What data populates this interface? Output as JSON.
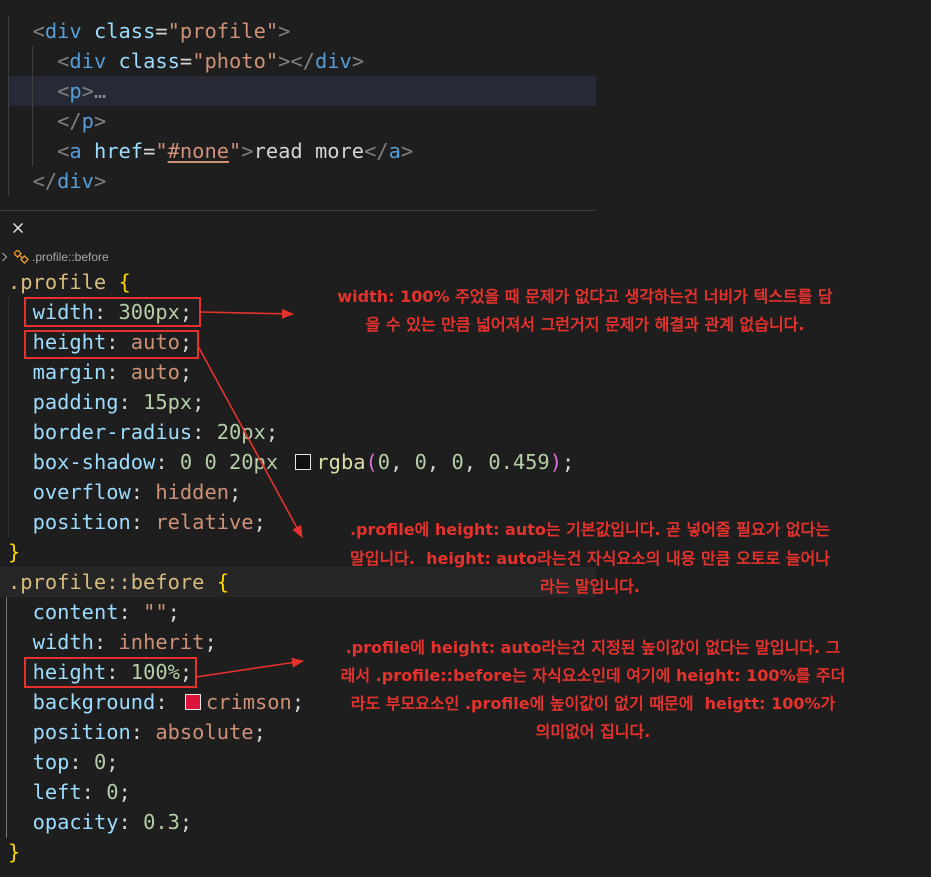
{
  "colors": {
    "annotation": "#e5322d"
  },
  "html_editor": {
    "lines": [
      [
        {
          "t": "  "
        },
        {
          "t": "<",
          "c": "#808080"
        },
        {
          "t": "div",
          "c": "#569cd6"
        },
        {
          "t": " "
        },
        {
          "t": "class",
          "c": "#9cdcfe"
        },
        {
          "t": "=",
          "c": "#d4d4d4"
        },
        {
          "t": "\"profile\"",
          "c": "#ce9178"
        },
        {
          "t": ">",
          "c": "#808080"
        }
      ],
      [
        {
          "t": "    "
        },
        {
          "t": "<",
          "c": "#808080"
        },
        {
          "t": "div",
          "c": "#569cd6"
        },
        {
          "t": " "
        },
        {
          "t": "class",
          "c": "#9cdcfe"
        },
        {
          "t": "=",
          "c": "#d4d4d4"
        },
        {
          "t": "\"photo\"",
          "c": "#ce9178"
        },
        {
          "t": ">",
          "c": "#808080"
        },
        {
          "t": "</",
          "c": "#808080"
        },
        {
          "t": "div",
          "c": "#569cd6"
        },
        {
          "t": ">",
          "c": "#808080"
        }
      ],
      [
        {
          "t": "    "
        },
        {
          "t": "<",
          "c": "#808080"
        },
        {
          "t": "p",
          "c": "#569cd6"
        },
        {
          "t": ">",
          "c": "#808080"
        },
        {
          "t": "…",
          "c": "#8c8c8c"
        }
      ],
      [
        {
          "t": "    "
        },
        {
          "t": "</",
          "c": "#808080"
        },
        {
          "t": "p",
          "c": "#569cd6"
        },
        {
          "t": ">",
          "c": "#808080"
        }
      ],
      [
        {
          "t": "    "
        },
        {
          "t": "<",
          "c": "#808080"
        },
        {
          "t": "a",
          "c": "#569cd6"
        },
        {
          "t": " "
        },
        {
          "t": "href",
          "c": "#9cdcfe"
        },
        {
          "t": "=",
          "c": "#d4d4d4"
        },
        {
          "t": "\"",
          "c": "#ce9178"
        },
        {
          "t": "#none",
          "c": "#ce9178",
          "underline": true
        },
        {
          "t": "\"",
          "c": "#ce9178"
        },
        {
          "t": ">",
          "c": "#808080"
        },
        {
          "t": "read more",
          "c": "#d4d4d4"
        },
        {
          "t": "</",
          "c": "#808080"
        },
        {
          "t": "a",
          "c": "#569cd6"
        },
        {
          "t": ">",
          "c": "#808080"
        }
      ],
      [
        {
          "t": "  "
        },
        {
          "t": "</",
          "c": "#808080"
        },
        {
          "t": "div",
          "c": "#569cd6"
        },
        {
          "t": ">",
          "c": "#808080"
        }
      ]
    ]
  },
  "panel": {
    "close_icon": "close-icon"
  },
  "breadcrumb": {
    "chevron_icon": "chevron-right-icon",
    "symbol_icon": "symbol-class-icon",
    "label": ".profile::before"
  },
  "css_editor": {
    "lines": [
      [
        {
          "t": ".profile",
          "c": "#d7ba7d"
        },
        {
          "t": " "
        },
        {
          "t": "{",
          "c": "#ffd700"
        }
      ],
      [
        {
          "t": "  "
        },
        {
          "t": "width",
          "c": "#9cdcfe"
        },
        {
          "t": ": "
        },
        {
          "t": "300px",
          "c": "#b5cea8"
        },
        {
          "t": ";"
        }
      ],
      [
        {
          "t": "  "
        },
        {
          "t": "height",
          "c": "#9cdcfe"
        },
        {
          "t": ": "
        },
        {
          "t": "auto",
          "c": "#ce9178"
        },
        {
          "t": ";"
        }
      ],
      [
        {
          "t": "  "
        },
        {
          "t": "margin",
          "c": "#9cdcfe"
        },
        {
          "t": ": "
        },
        {
          "t": "auto",
          "c": "#ce9178"
        },
        {
          "t": ";"
        }
      ],
      [
        {
          "t": "  "
        },
        {
          "t": "padding",
          "c": "#9cdcfe"
        },
        {
          "t": ": "
        },
        {
          "t": "15px",
          "c": "#b5cea8"
        },
        {
          "t": ";"
        }
      ],
      [
        {
          "t": "  "
        },
        {
          "t": "border-radius",
          "c": "#9cdcfe"
        },
        {
          "t": ": "
        },
        {
          "t": "20px",
          "c": "#b5cea8"
        },
        {
          "t": ";"
        }
      ],
      [
        {
          "t": "  "
        },
        {
          "t": "box-shadow",
          "c": "#9cdcfe"
        },
        {
          "t": ": "
        },
        {
          "t": "0 0 20px",
          "c": "#b5cea8"
        },
        {
          "t": " "
        },
        {
          "swatch": "#00000075"
        },
        {
          "t": "rgba",
          "c": "#dcdcaa"
        },
        {
          "t": "(",
          "c": "#da70d6"
        },
        {
          "t": "0",
          "c": "#b5cea8"
        },
        {
          "t": ", "
        },
        {
          "t": "0",
          "c": "#b5cea8"
        },
        {
          "t": ", "
        },
        {
          "t": "0",
          "c": "#b5cea8"
        },
        {
          "t": ", "
        },
        {
          "t": "0.459",
          "c": "#b5cea8"
        },
        {
          "t": ")",
          "c": "#da70d6"
        },
        {
          "t": ";"
        }
      ],
      [
        {
          "t": "  "
        },
        {
          "t": "overflow",
          "c": "#9cdcfe"
        },
        {
          "t": ": "
        },
        {
          "t": "hidden",
          "c": "#ce9178"
        },
        {
          "t": ";"
        }
      ],
      [
        {
          "t": "  "
        },
        {
          "t": "position",
          "c": "#9cdcfe"
        },
        {
          "t": ": "
        },
        {
          "t": "relative",
          "c": "#ce9178"
        },
        {
          "t": ";"
        }
      ],
      [
        {
          "t": "}",
          "c": "#ffd700"
        }
      ],
      [
        {
          "t": ".profile::before",
          "c": "#d7ba7d"
        },
        {
          "t": " "
        },
        {
          "t": "{",
          "c": "#ffd700"
        }
      ],
      [
        {
          "t": "  "
        },
        {
          "t": "content",
          "c": "#9cdcfe"
        },
        {
          "t": ": "
        },
        {
          "t": "\"\"",
          "c": "#ce9178"
        },
        {
          "t": ";"
        }
      ],
      [
        {
          "t": "  "
        },
        {
          "t": "width",
          "c": "#9cdcfe"
        },
        {
          "t": ": "
        },
        {
          "t": "inherit",
          "c": "#ce9178"
        },
        {
          "t": ";"
        }
      ],
      [
        {
          "t": "  "
        },
        {
          "t": "height",
          "c": "#9cdcfe"
        },
        {
          "t": ": "
        },
        {
          "t": "100%",
          "c": "#b5cea8"
        },
        {
          "t": ";"
        }
      ],
      [
        {
          "t": "  "
        },
        {
          "t": "background",
          "c": "#9cdcfe"
        },
        {
          "t": ": "
        },
        {
          "swatch": "#dc143c"
        },
        {
          "t": "crimson",
          "c": "#ce9178"
        },
        {
          "t": ";"
        }
      ],
      [
        {
          "t": "  "
        },
        {
          "t": "position",
          "c": "#9cdcfe"
        },
        {
          "t": ": "
        },
        {
          "t": "absolute",
          "c": "#ce9178"
        },
        {
          "t": ";"
        }
      ],
      [
        {
          "t": "  "
        },
        {
          "t": "top",
          "c": "#9cdcfe"
        },
        {
          "t": ": "
        },
        {
          "t": "0",
          "c": "#b5cea8"
        },
        {
          "t": ";"
        }
      ],
      [
        {
          "t": "  "
        },
        {
          "t": "left",
          "c": "#9cdcfe"
        },
        {
          "t": ": "
        },
        {
          "t": "0",
          "c": "#b5cea8"
        },
        {
          "t": ";"
        }
      ],
      [
        {
          "t": "  "
        },
        {
          "t": "opacity",
          "c": "#9cdcfe"
        },
        {
          "t": ": "
        },
        {
          "t": "0.3",
          "c": "#b5cea8"
        },
        {
          "t": ";"
        }
      ],
      [
        {
          "t": "}",
          "c": "#ffd700"
        }
      ]
    ]
  },
  "annotations": [
    {
      "lines": [
        "width: 100% 주었을 때 문제가 없다고 생각하는건 너비가 텍스트를 담",
        "을 수 있는 만큼 넓어져서 그런거지 문제가 해결과 관계 없습니다."
      ]
    },
    {
      "lines": [
        ".profile에 height: auto는 기본값입니다. 곧 넣어줄 필요가 없다는",
        "말입니다.  height: auto라는건 자식요소의 내용 만큼 오토로 늘어나",
        "라는 말입니다."
      ]
    },
    {
      "lines": [
        ".profile에 height: auto라는건 지정된 높이값이 없다는 말입니다. 그",
        "래서 .profile::before는 자식요소인데 여기에 height: 100%를 주더",
        "라도 부모요소인 .profile에 높이값이 없기 때문에  heigtt: 100%가",
        "의미없어 집니다."
      ]
    }
  ]
}
